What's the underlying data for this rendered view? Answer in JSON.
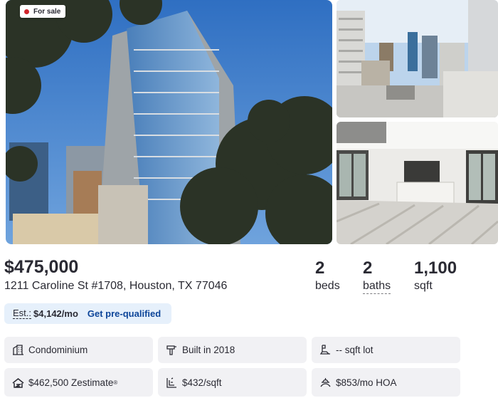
{
  "listing": {
    "status_badge": "For sale",
    "status_color": "#d1252c",
    "price": "$475,000",
    "address": "1211 Caroline St #1708, Houston, TX 77046",
    "beds": {
      "value": "2",
      "label": "beds"
    },
    "baths": {
      "value": "2",
      "label": "baths"
    },
    "sqft": {
      "value": "1,100",
      "label": "sqft"
    }
  },
  "estimate": {
    "label": "Est.:",
    "value": "$4,142/mo",
    "cta": "Get pre-qualified"
  },
  "facts": [
    {
      "icon": "building-icon",
      "text": "Condominium"
    },
    {
      "icon": "hammer-icon",
      "text": "Built in 2018"
    },
    {
      "icon": "lot-icon",
      "text": "-- sqft lot"
    },
    {
      "icon": "zestimate-icon",
      "text": "$462,500 Zestimate",
      "suffix": "®"
    },
    {
      "icon": "price-per-sqft-icon",
      "text": "$432/sqft"
    },
    {
      "icon": "hoa-icon",
      "text": "$853/mo HOA"
    }
  ],
  "colors": {
    "accent": "#0d4599",
    "pill_bg": "#e6f0fb",
    "fact_bg": "#f1f1f4",
    "text": "#2a2a33"
  }
}
